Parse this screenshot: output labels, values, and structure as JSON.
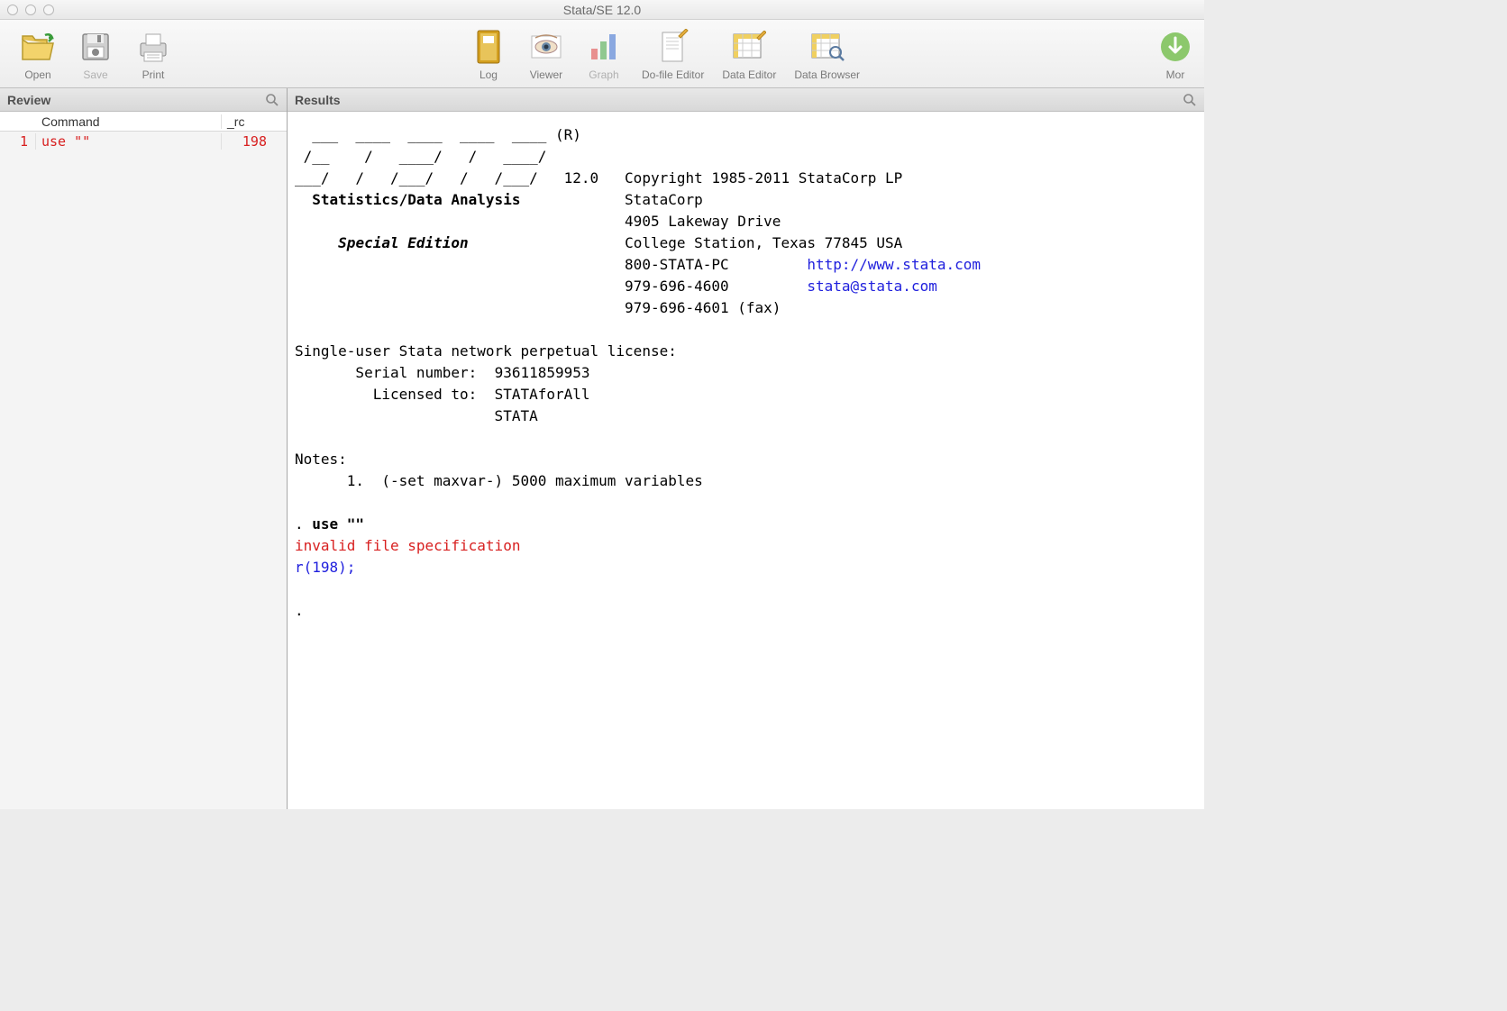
{
  "window": {
    "title": "Stata/SE 12.0"
  },
  "toolbar": {
    "open": "Open",
    "save": "Save",
    "print": "Print",
    "log": "Log",
    "viewer": "Viewer",
    "graph": "Graph",
    "dofile": "Do-file Editor",
    "dataeditor": "Data Editor",
    "databrowser": "Data Browser",
    "more": "Mor"
  },
  "review": {
    "title": "Review",
    "cols": {
      "num": "",
      "command": "Command",
      "rc": "_rc"
    },
    "rows": [
      {
        "n": "1",
        "cmd": "use \"\"",
        "rc": "198"
      }
    ]
  },
  "results": {
    "title": "Results",
    "ascii_line1": "  ___  ____  ____  ____  ____ (R)",
    "ascii_line2": " /__    /   ____/   /   ____/",
    "ascii_line3": "___/   /   /___/   /   /___/   12.0   Copyright 1985-2011 StataCorp LP",
    "tagline": "  Statistics/Data Analysis",
    "company": "StataCorp",
    "addr1": "4905 Lakeway Drive",
    "edition": "Special Edition",
    "addr2": "College Station, Texas 77845 USA",
    "phone1": "800-STATA-PC",
    "url": "http://www.stata.com",
    "phone2": "979-696-4600",
    "email": "stata@stata.com",
    "fax": "979-696-4601 (fax)",
    "license_header": "Single-user Stata network perpetual license:",
    "serial_label": "       Serial number:  ",
    "serial": "93611859953",
    "licensed_label": "         Licensed to:  ",
    "licensed_to": "STATAforAll",
    "licensed_org": "                       STATA",
    "notes_header": "Notes:",
    "note1": "      1.  (-set maxvar-) 5000 maximum variables",
    "cmd_prompt": ". ",
    "cmd": "use \"\"",
    "error_msg": "invalid file specification",
    "error_code": "r(198);",
    "prompt2": "."
  }
}
